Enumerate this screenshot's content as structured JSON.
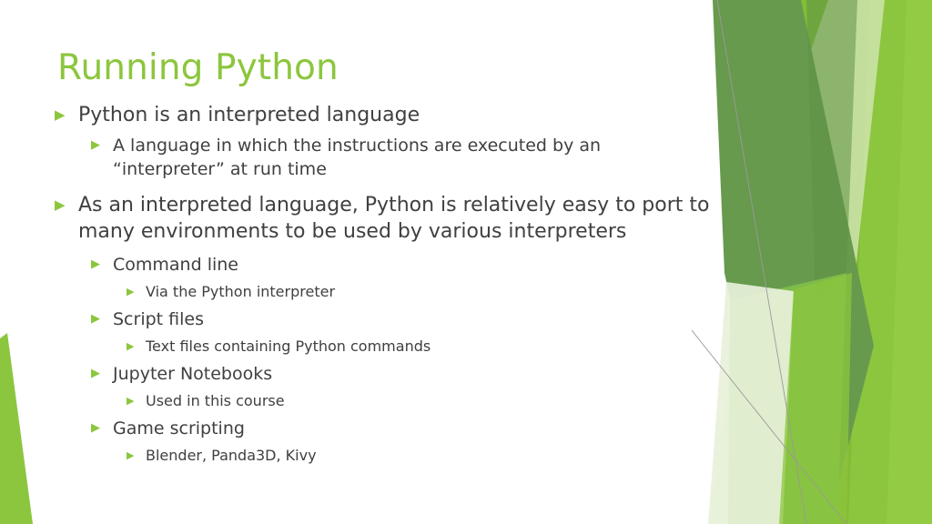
{
  "slide": {
    "title": "Running Python",
    "title_color": "#8CC63E",
    "body_text_color": "#404040",
    "background_color": "#FFFFFF",
    "bullet_marker_glyph": "▶",
    "bullet_marker_name": "triangle-right-bullet-icon",
    "bullets": [
      {
        "level": 1,
        "text": "Python is an interpreted language"
      },
      {
        "level": 2,
        "text": "A language in which the instructions are executed by an “interpreter” at run time"
      },
      {
        "level": 1,
        "text": "As an interpreted language, Python is relatively easy to port to many environments to be used by various interpreters"
      },
      {
        "level": 2,
        "text": "Command line"
      },
      {
        "level": 3,
        "text": "Via the Python interpreter"
      },
      {
        "level": 2,
        "text": "Script files"
      },
      {
        "level": 3,
        "text": "Text files containing Python commands"
      },
      {
        "level": 2,
        "text": "Jupyter Notebooks"
      },
      {
        "level": 3,
        "text": "Used in this course"
      },
      {
        "level": 2,
        "text": "Game scripting"
      },
      {
        "level": 3,
        "text": "Blender, Panda3D, Kivy"
      }
    ]
  },
  "decoration": {
    "name": "facet-theme-green-shards",
    "colors": {
      "dark_green": "#679A4D",
      "deep_green": "#5E9145",
      "mid_green": "#7FB135",
      "bright_green": "#8CC63E",
      "light_green": "#A8D054",
      "pale_green": "#CFE4AE",
      "paler_green": "#DFECCC",
      "palest_green": "#EDF4E0",
      "hairline": "#9A9A9A"
    }
  }
}
